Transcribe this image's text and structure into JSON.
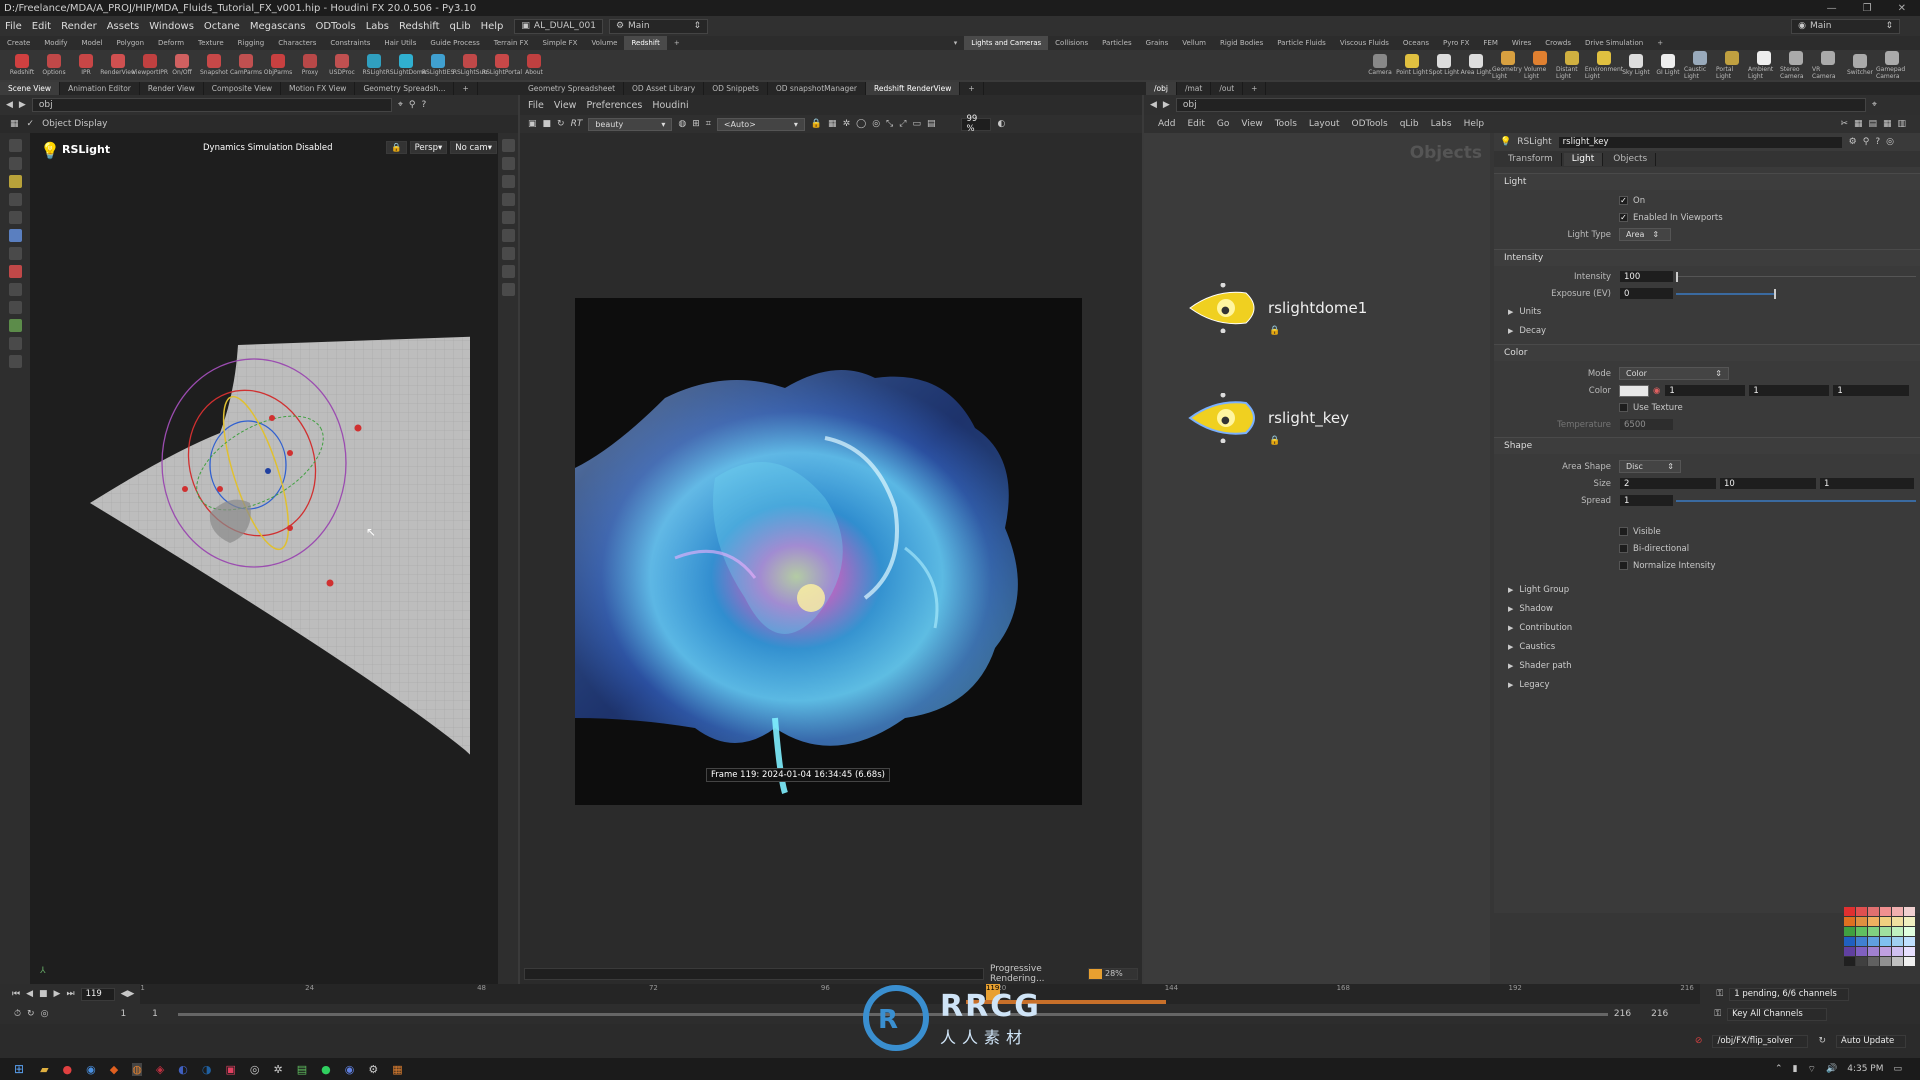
{
  "app": {
    "title": "D:/Freelance/MDA/A_PROJ/HIP/MDA_Fluids_Tutorial_FX_v001.hip - Houdini FX 20.0.506 - Py3.10",
    "desktop_label": "AL_DUAL_001",
    "desktop_main": "Main",
    "right_main": "Main"
  },
  "menu": [
    "File",
    "Edit",
    "Render",
    "Assets",
    "Windows",
    "Octane",
    "Megascans",
    "ODTools",
    "Labs",
    "Redshift",
    "qLib",
    "Help"
  ],
  "shelf_tabs_left": [
    "Create",
    "Modify",
    "Model",
    "Polygon",
    "Deform",
    "Texture",
    "Rigging",
    "Characters",
    "Constraints",
    "Hair Utils",
    "Guide Process",
    "Terrain FX",
    "Simple FX",
    "Volume",
    "Redshift"
  ],
  "shelf_tabs_right": [
    "Lights and Cameras",
    "Collisions",
    "Particles",
    "Grains",
    "Vellum",
    "Rigid Bodies",
    "Particle Fluids",
    "Viscous Fluids",
    "Oceans",
    "Pyro FX",
    "FEM",
    "Wires",
    "Crowds",
    "Drive Simulation"
  ],
  "tools_left": [
    {
      "label": "Redshift",
      "color": "#d04040"
    },
    {
      "label": "Options",
      "color": "#c04848"
    },
    {
      "label": "IPR",
      "color": "#c84646"
    },
    {
      "label": "RenderView",
      "color": "#d05050"
    },
    {
      "label": "ViewportIPR",
      "color": "#c04040"
    },
    {
      "label": "On/Off",
      "color": "#d06060"
    },
    {
      "label": "Snapshot",
      "color": "#c84848"
    },
    {
      "label": "CamParms",
      "color": "#c05050"
    },
    {
      "label": "ObjParms",
      "color": "#c84040"
    },
    {
      "label": "Proxy",
      "color": "#b84848"
    },
    {
      "label": "USDProc",
      "color": "#c05050"
    },
    {
      "label": "RSLight",
      "color": "#30a0c0"
    },
    {
      "label": "RSLightDome",
      "color": "#30b0d0"
    },
    {
      "label": "RSLightIES",
      "color": "#40a0d0"
    },
    {
      "label": "RSLightSun",
      "color": "#c04848"
    },
    {
      "label": "RSLightPortal",
      "color": "#c84848"
    },
    {
      "label": "About",
      "color": "#c04040"
    }
  ],
  "tools_right": [
    {
      "label": "Camera",
      "color": "#888"
    },
    {
      "label": "Point Light",
      "color": "#e0c040"
    },
    {
      "label": "Spot Light",
      "color": "#ddd"
    },
    {
      "label": "Area Light",
      "color": "#ddd"
    },
    {
      "label": "Geometry Light",
      "color": "#d8a040"
    },
    {
      "label": "Volume Light",
      "color": "#e08030"
    },
    {
      "label": "Distant Light",
      "color": "#d0b040"
    },
    {
      "label": "Environment Light",
      "color": "#e0c040"
    },
    {
      "label": "Sky Light",
      "color": "#ddd"
    },
    {
      "label": "GI Light",
      "color": "#eee"
    },
    {
      "label": "Caustic Light",
      "color": "#9ab"
    },
    {
      "label": "Portal Light",
      "color": "#c0a040"
    },
    {
      "label": "Ambient Light",
      "color": "#eee"
    },
    {
      "label": "Stereo Camera",
      "color": "#aaa"
    },
    {
      "label": "VR Camera",
      "color": "#aaa"
    },
    {
      "label": "Switcher",
      "color": "#aaa"
    },
    {
      "label": "Gamepad Camera",
      "color": "#aaa"
    }
  ],
  "pane_tabs_left": [
    "Scene View",
    "Animation Editor",
    "Render View",
    "Composite View",
    "Motion FX View",
    "Geometry Spreadsh..."
  ],
  "pane_tabs_mid": [
    "Geometry Spreadsheet",
    "OD Asset Library",
    "OD Snippets",
    "OD snapshotManager",
    "Redshift RenderView"
  ],
  "pane_tabs_right": [
    "/obj",
    "/mat",
    "/out"
  ],
  "viewport": {
    "path": "obj",
    "display_label": "Object Display",
    "node_name": "RSLight",
    "sim_status": "Dynamics Simulation Disabled",
    "persp": "Persp",
    "cam": "No cam"
  },
  "renderview": {
    "menu": [
      "File",
      "View",
      "Preferences",
      "Houdini"
    ],
    "aov": "beauty",
    "camera": "<Auto>",
    "zoom": "99 %",
    "frame_info": "Frame 119: 2024-01-04 16:34:45 (6.68s)",
    "status": "Progressive Rendering...",
    "progress_label": "28%",
    "progress": 0.28
  },
  "network": {
    "path": "obj",
    "menu": [
      "Add",
      "Edit",
      "Go",
      "View",
      "Tools",
      "Layout",
      "ODTools",
      "qLib",
      "Labs",
      "Help"
    ],
    "watermark": "Objects",
    "nodes": [
      "rslightdome1",
      "rslight_key"
    ]
  },
  "params": {
    "node_type": "RSLight",
    "node_name": "rslight_key",
    "tabs": [
      "Transform",
      "Light",
      "Objects"
    ],
    "section_light": "Light",
    "on_label": "On",
    "enabled_label": "Enabled In Viewports",
    "light_type_label": "Light Type",
    "light_type": "Area",
    "section_intensity": "Intensity",
    "intensity_label": "Intensity",
    "intensity": "100",
    "exposure_label": "Exposure (EV)",
    "exposure": "0",
    "units": "Units",
    "decay": "Decay",
    "section_color": "Color",
    "mode_label": "Mode",
    "mode": "Color",
    "color_label": "Color",
    "color_r": "1",
    "color_g": "1",
    "color_b": "1",
    "use_texture": "Use Texture",
    "temperature_label": "Temperature",
    "temperature": "6500",
    "section_shape": "Shape",
    "area_shape_label": "Area Shape",
    "area_shape": "Disc",
    "size_label": "Size",
    "size_x": "2",
    "size_y": "10",
    "size_z": "1",
    "spread_label": "Spread",
    "spread": "1",
    "visible": "Visible",
    "bidirectional": "Bi-directional",
    "normalize": "Normalize Intensity",
    "collapsed": [
      "Light Group",
      "Shadow",
      "Contribution",
      "Caustics",
      "Shader path",
      "Legacy"
    ]
  },
  "timeline": {
    "frame": "119",
    "start": "1",
    "start2": "1",
    "end": "216",
    "end2": "216",
    "ticks": [
      "1",
      "24",
      "48",
      "72",
      "96",
      "120",
      "144",
      "168",
      "192",
      "216"
    ],
    "channels": "1 pending, 6/6 channels",
    "key_all": "Key All Channels",
    "solver_path": "/obj/FX/flip_solver",
    "auto_update": "Auto Update"
  },
  "taskbar": {
    "time": "4:35 PM"
  },
  "watermark_text": "RRCG",
  "watermark_sub": "人人素材",
  "colors": {
    "accent": "#e8a030",
    "flip": "#8ad0ff",
    "light_bulb": "#f0d020"
  }
}
